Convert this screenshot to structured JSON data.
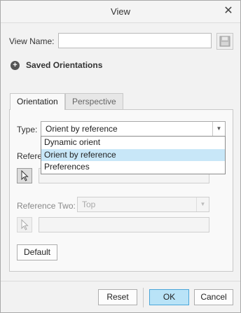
{
  "window": {
    "title": "View"
  },
  "view_name": {
    "label": "View Name:",
    "value": "",
    "placeholder": ""
  },
  "saved_orientations": {
    "label": "Saved Orientations"
  },
  "tabs": [
    {
      "label": "Orientation",
      "active": true
    },
    {
      "label": "Perspective",
      "active": false
    }
  ],
  "orientation": {
    "type_label": "Type:",
    "type_value": "Orient by reference",
    "type_options": [
      "Dynamic orient",
      "Orient by reference",
      "Preferences"
    ],
    "reference_one_label_visible": "Refere",
    "reference_one_value": "",
    "reference_two_label": "Reference Two:",
    "reference_two_value": "Top",
    "reference_two_field_value": ""
  },
  "buttons": {
    "default": "Default",
    "reset": "Reset",
    "ok": "OK",
    "cancel": "Cancel"
  },
  "colors": {
    "accent": "#b9e3f7",
    "accent_border": "#4ba6d9",
    "selection": "#c8e7f8"
  },
  "icons": {
    "close": "close-icon",
    "save": "save-icon",
    "expand": "plus-icon",
    "dropdown": "chevron-down-icon",
    "pointer": "pointer-icon"
  }
}
